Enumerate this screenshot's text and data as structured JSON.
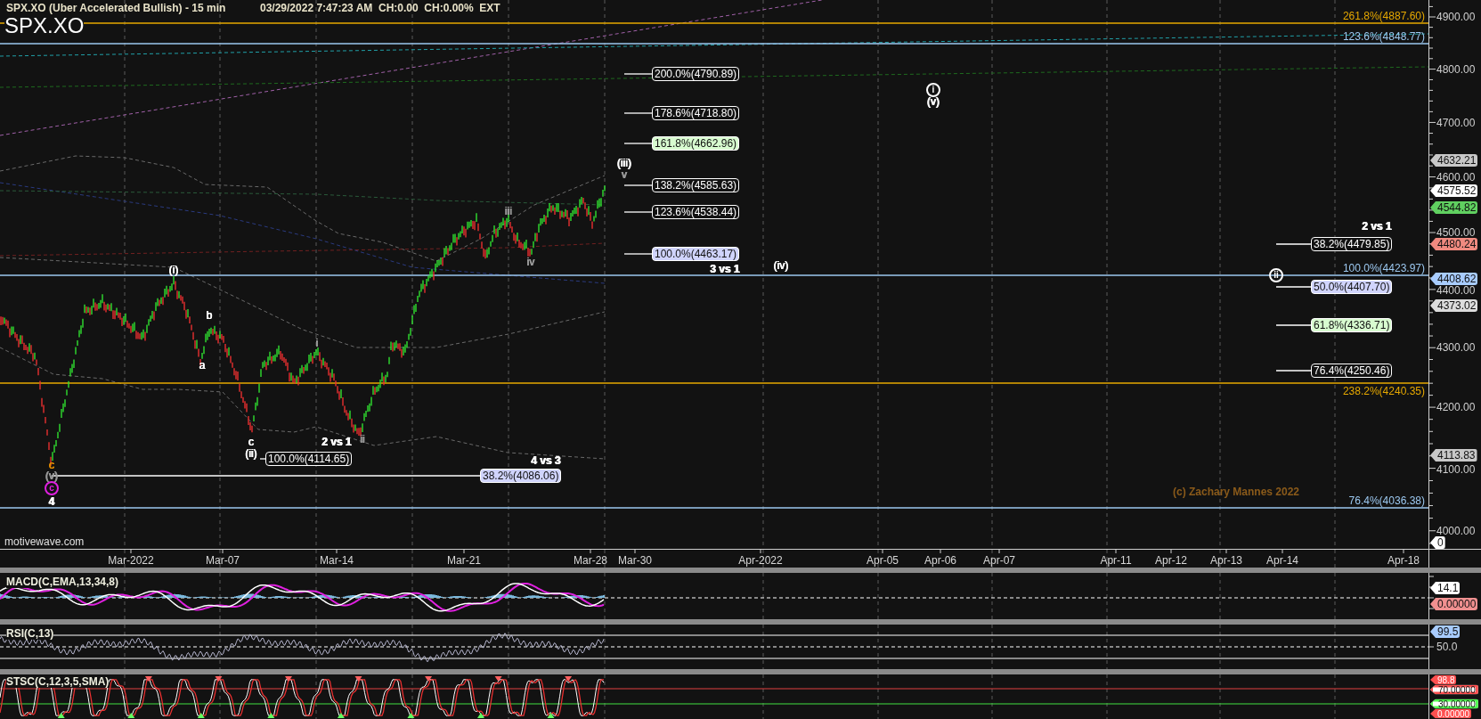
{
  "header": {
    "title": "SPX.XO (Uber Accelerated Bullish) - 15 min",
    "status": "03/29/2022 7:47:23 AM  CH:0.00  CH:0.00%  EXT",
    "symbol": "SPX.XO"
  },
  "price_pane": {
    "levels": [
      {
        "label": "261.8%(4887.60)",
        "color": "#e6a800"
      },
      {
        "label": "123.6%(4848.77)",
        "color": "#9cc8f0"
      },
      {
        "label": "100.0%(4423.97)",
        "color": "#9cc8f0"
      },
      {
        "label": "238.2%(4240.35)",
        "color": "#e6a800"
      },
      {
        "label": "76.4%(4036.38)",
        "color": "#9cc8f0"
      }
    ],
    "fib_targets": [
      {
        "label": "200.0%(4790.89)",
        "color": "#121212"
      },
      {
        "label": "178.6%(4718.80)",
        "color": "#121212"
      },
      {
        "label": "161.8%(4662.96)",
        "color": "#d8fcd0"
      },
      {
        "label": "138.2%(4585.63)",
        "color": "#121212"
      },
      {
        "label": "123.6%(4538.44)",
        "color": "#121212"
      },
      {
        "label": "38.2%(4479.85)",
        "color": "#121212"
      },
      {
        "label": "100.0%(4463.17)",
        "color": "#d0d4fc"
      },
      {
        "label": "50.0%(4407.70)",
        "color": "#d0d4fc"
      },
      {
        "label": "61.8%(4336.71)",
        "color": "#d8fcd0"
      },
      {
        "label": "76.4%(4250.46)",
        "color": "#121212"
      },
      {
        "label": "100.0%(4114.65)",
        "color": "#121212"
      },
      {
        "label": "38.2%(4086.06)",
        "color": "#d0d4fc"
      }
    ],
    "wave_labels": [
      {
        "text": "i",
        "kind": "circled",
        "color": "#ffffff"
      },
      {
        "text": "(v)",
        "kind": "plain",
        "color": "#ffffff"
      },
      {
        "text": "(iii)",
        "kind": "plain",
        "color": "#ffffff"
      },
      {
        "text": "v",
        "kind": "plain",
        "color": "#9a9a9a"
      },
      {
        "text": "iii",
        "kind": "plain",
        "color": "#9a9a9a"
      },
      {
        "text": "2 vs 1",
        "kind": "bold",
        "color": "#ffffff"
      },
      {
        "text": "iv",
        "kind": "plain",
        "color": "#9a9a9a"
      },
      {
        "text": "3 vs 1",
        "kind": "bold",
        "color": "#ffffff"
      },
      {
        "text": "(iv)",
        "kind": "plain",
        "color": "#ffffff"
      },
      {
        "text": "(i)",
        "kind": "plain",
        "color": "#ffffff"
      },
      {
        "text": "ii",
        "kind": "circled",
        "color": "#ffffff"
      },
      {
        "text": "b",
        "kind": "plain",
        "color": "#ffffff"
      },
      {
        "text": "i",
        "kind": "plain",
        "color": "#9a9a9a"
      },
      {
        "text": "a",
        "kind": "plain",
        "color": "#ffffff"
      },
      {
        "text": "ii",
        "kind": "plain",
        "color": "#9a9a9a"
      },
      {
        "text": "c",
        "kind": "plain",
        "color": "#ffffff"
      },
      {
        "text": "2 vs 1",
        "kind": "bold",
        "color": "#ffffff"
      },
      {
        "text": "(ii)",
        "kind": "plain",
        "color": "#ffffff"
      },
      {
        "text": "4 vs 3",
        "kind": "bold",
        "color": "#ffffff"
      },
      {
        "text": "c",
        "kind": "plain",
        "color": "#e08a00"
      },
      {
        "text": "(v)",
        "kind": "plain",
        "color": "#9a9a9a"
      },
      {
        "text": "c",
        "kind": "circled",
        "color": "#e020e0"
      },
      {
        "text": "4",
        "kind": "bold",
        "color": "#ffffff"
      }
    ],
    "copyright": "(c) Zachary Mannes 2022",
    "brand": "motivewave.com",
    "y_axis": [
      "4900.00",
      "4800.00",
      "4700.00",
      "4600.00",
      "4500.00",
      "4400.00",
      "4300.00",
      "4200.00",
      "4100.00",
      "4000.00"
    ],
    "price_tags": [
      {
        "text": "4632.21",
        "color": "#c8c8c8",
        "kind": "solid"
      },
      {
        "text": "4575.52",
        "color": "#ffffff",
        "kind": "solid"
      },
      {
        "text": "4544.82",
        "color": "#60d060",
        "kind": "solid"
      },
      {
        "text": "4480.24",
        "color": "#f08a80",
        "kind": "solid"
      },
      {
        "text": "4408.62",
        "color": "#a8ccff",
        "kind": "solid"
      },
      {
        "text": "4373.02",
        "color": "#dcdcdc",
        "kind": "solid"
      },
      {
        "text": "4113.83",
        "color": "#c8c8c8",
        "kind": "solid"
      },
      {
        "text": "0",
        "color": "#ffffff",
        "kind": "solid"
      }
    ]
  },
  "x_axis": [
    "Mar-2022",
    "Mar-07",
    "Mar-14",
    "Mar-21",
    "Mar-28",
    "Mar-30",
    "Apr-2022",
    "Apr-05",
    "Apr-06",
    "Apr-07",
    "Apr-11",
    "Apr-12",
    "Apr-13",
    "Apr-14",
    "Apr-18"
  ],
  "macd": {
    "label": "MACD(C,EMA,13,34,8)",
    "tags": [
      {
        "text": "14.1",
        "color": "#ffffff",
        "kind": "solid"
      },
      {
        "text": "0.00000",
        "color": "#f09090",
        "kind": "solid"
      }
    ]
  },
  "rsi": {
    "label": "RSI(C,13)",
    "tags": [
      {
        "text": "99.5",
        "color": "#a8ccff",
        "kind": "solid"
      }
    ],
    "ticks": [
      "50.0"
    ]
  },
  "stsc": {
    "label": "STSC(C,12,3,5,SMA)",
    "tags": [
      {
        "text": "98.8",
        "color": "#ff5050",
        "kind": "solid"
      },
      {
        "text": "70.00000",
        "color": "#ff5050",
        "kind": "outline"
      },
      {
        "text": "30.00000",
        "color": "#50ff50",
        "kind": "outline"
      },
      {
        "text": "0.00000",
        "color": "#ff5050",
        "kind": "solid"
      }
    ]
  }
}
